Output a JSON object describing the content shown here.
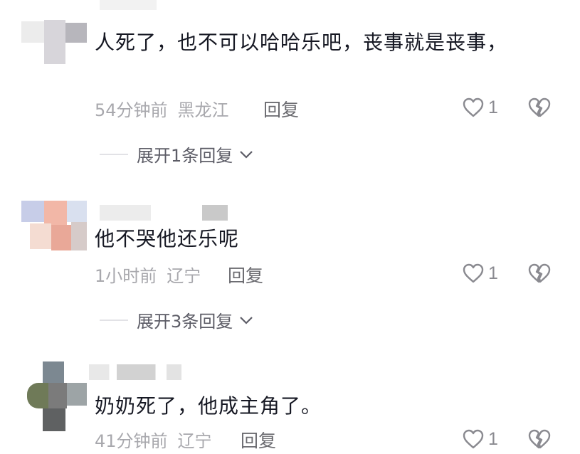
{
  "comments": [
    {
      "text": "人死了，也不可以哈哈乐吧，丧事就是丧事，",
      "time": "54分钟前",
      "location": "黑龙江",
      "reply_label": "回复",
      "like_count": "1",
      "expand_label": "展开1条回复"
    },
    {
      "text": "他不哭他还乐呢",
      "time": "1小时前",
      "location": "辽宁",
      "reply_label": "回复",
      "like_count": "1",
      "expand_label": "展开3条回复"
    },
    {
      "text": "奶奶死了，他成主角了。",
      "time": "41分钟前",
      "location": "辽宁",
      "reply_label": "回复",
      "like_count": "1"
    }
  ],
  "icons": {
    "like": "heart-outline-icon",
    "dislike": "broken-heart-icon",
    "expand": "chevron-down-icon"
  },
  "colors": {
    "text": "#161823",
    "meta": "#a8a8ad",
    "reply": "#6b6b70",
    "icon": "#8a8a90"
  }
}
